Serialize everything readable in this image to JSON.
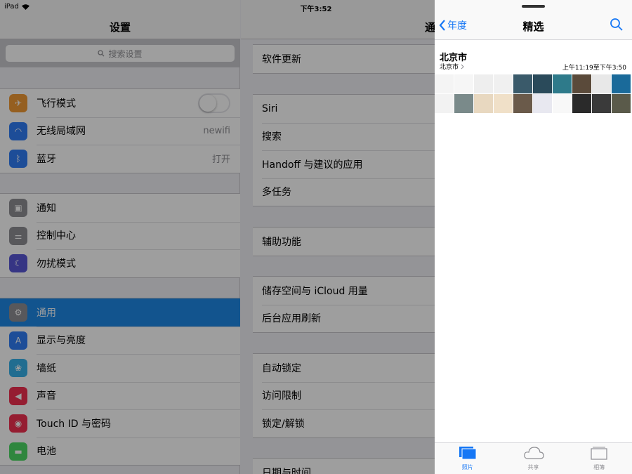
{
  "status": {
    "device": "iPad",
    "time": "下午3:52"
  },
  "settings": {
    "title": "设置",
    "search_placeholder": "搜索设置",
    "groups": [
      [
        {
          "label": "飞行模式",
          "icon": "airplane-icon",
          "color": "#f19a34",
          "control": "toggle-off"
        },
        {
          "label": "无线局域网",
          "icon": "wifi-icon",
          "color": "#2f7cf6",
          "value": "newifi"
        },
        {
          "label": "蓝牙",
          "icon": "bluetooth-icon",
          "color": "#2f7cf6",
          "value": "打开"
        }
      ],
      [
        {
          "label": "通知",
          "icon": "notifications-icon",
          "color": "#8e8e93"
        },
        {
          "label": "控制中心",
          "icon": "control-center-icon",
          "color": "#8e8e93"
        },
        {
          "label": "勿扰模式",
          "icon": "moon-icon",
          "color": "#5856d6"
        }
      ],
      [
        {
          "label": "通用",
          "icon": "gear-icon",
          "color": "#8e8e93",
          "selected": true
        },
        {
          "label": "显示与亮度",
          "icon": "display-brightness-icon",
          "color": "#2f7cf6"
        },
        {
          "label": "墙纸",
          "icon": "wallpaper-icon",
          "color": "#36b0e8"
        },
        {
          "label": "声音",
          "icon": "speaker-icon",
          "color": "#f0304f"
        },
        {
          "label": "Touch ID 与密码",
          "icon": "fingerprint-icon",
          "color": "#f0304f"
        },
        {
          "label": "电池",
          "icon": "battery-icon",
          "color": "#4cd964"
        }
      ]
    ]
  },
  "detail": {
    "title": "通",
    "groups": [
      [
        "软件更新"
      ],
      [
        "Siri",
        "搜索",
        "Handoff 与建议的应用",
        "多任务"
      ],
      [
        "辅助功能"
      ],
      [
        "储存空间与 iCloud 用量",
        "后台应用刷新"
      ],
      [
        "自动锁定",
        "访问限制",
        "锁定/解锁"
      ],
      [
        "日期与时间"
      ]
    ]
  },
  "photos": {
    "back_label": "年度",
    "title": "精选",
    "location": "北京市",
    "sublocation": "北京市",
    "time_range": "上午11:19至下午3:50",
    "thumb_colors": [
      "#f4f4f4",
      "#f6f6f6",
      "#eeeeee",
      "#f0f0f0",
      "#3a5a6a",
      "#2a4a5a",
      "#2e7a8a",
      "#5a4a3a",
      "#e8e8e8",
      "#1a6a9a",
      "#f2f2f2",
      "#7a8a8a",
      "#e8d8c0",
      "#f0e0c8",
      "#6a5a4a",
      "#e8e8f0",
      "#f8f8f8",
      "#2a2a2a",
      "#3a3a3a",
      "#5a5a4a"
    ],
    "tabs": [
      {
        "label": "照片",
        "icon": "photos-tab-icon",
        "active": true
      },
      {
        "label": "共享",
        "icon": "cloud-icon",
        "active": false
      },
      {
        "label": "相簿",
        "icon": "albums-icon",
        "active": false
      }
    ]
  }
}
